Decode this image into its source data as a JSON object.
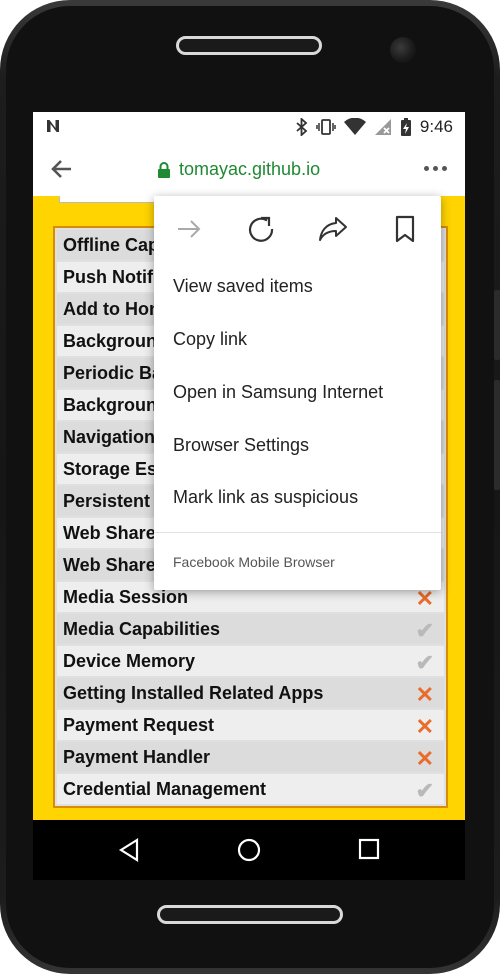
{
  "statusbar": {
    "left_icon": "n-notification-icon",
    "time": "9:46"
  },
  "browser": {
    "url": "tomayac.github.io"
  },
  "features": [
    {
      "label": "Offline Cap",
      "status": "none"
    },
    {
      "label": "Push Notifi",
      "status": "none"
    },
    {
      "label": "Add to Hon",
      "status": "none"
    },
    {
      "label": "Backgroun",
      "status": "none"
    },
    {
      "label": "Periodic Ba",
      "status": "none"
    },
    {
      "label": "Backgroun",
      "status": "none"
    },
    {
      "label": "Navigation",
      "status": "none"
    },
    {
      "label": "Storage Es",
      "status": "none"
    },
    {
      "label": "Persistent",
      "status": "none"
    },
    {
      "label": "Web Share",
      "status": "none"
    },
    {
      "label": "Web Share",
      "status": "none"
    },
    {
      "label": "Media Session",
      "status": "unsupported"
    },
    {
      "label": "Media Capabilities",
      "status": "supported"
    },
    {
      "label": "Device Memory",
      "status": "supported"
    },
    {
      "label": "Getting Installed Related Apps",
      "status": "unsupported"
    },
    {
      "label": "Payment Request",
      "status": "unsupported"
    },
    {
      "label": "Payment Handler",
      "status": "unsupported"
    },
    {
      "label": "Credential Management",
      "status": "supported"
    }
  ],
  "symbols": {
    "cross": "✕",
    "check": "✔"
  },
  "menu": {
    "items": [
      "View saved items",
      "Copy link",
      "Open in Samsung Internet",
      "Browser Settings",
      "Mark link as suspicious"
    ],
    "footer": "Facebook Mobile Browser"
  },
  "colors": {
    "page_background": "#ffd400",
    "url_green": "#1f8a33",
    "cross": "#e96c2c",
    "check": "#b9b9b9"
  }
}
